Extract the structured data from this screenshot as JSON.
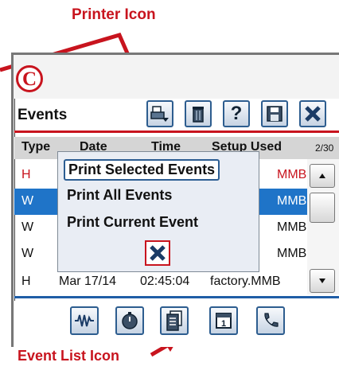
{
  "annotations": {
    "top_label": "Printer Icon",
    "bottom_label": "Event List Icon",
    "badge": "C"
  },
  "screen": {
    "title": "Events"
  },
  "table": {
    "headers": [
      "Type",
      "Date",
      "Time",
      "Setup Used"
    ],
    "count": "2/30",
    "rows": [
      {
        "type": "H",
        "date": "",
        "time": "",
        "setup_suffix": "MMB"
      },
      {
        "type": "W",
        "date": "",
        "time": "",
        "setup_suffix": "MMB"
      },
      {
        "type": "W",
        "date": "",
        "time": "",
        "setup_suffix": "MMB"
      },
      {
        "type": "W",
        "date": "",
        "time": "",
        "setup_suffix": "MMB"
      },
      {
        "type": "H",
        "date": "Mar 17/14",
        "time": "02:45:04",
        "setup": "factory.MMB"
      }
    ]
  },
  "print_menu": {
    "items": [
      "Print Selected Events",
      "Print All Events",
      "Print Current Event"
    ]
  },
  "icons": {
    "toolbar": [
      "printer-icon",
      "trash-icon",
      "help-icon",
      "save-icon",
      "close-icon"
    ],
    "nav": [
      "waveform-icon",
      "timer-icon",
      "event-list-icon",
      "calendar-icon",
      "phone-icon"
    ]
  },
  "colors": {
    "accent": "#c8141e",
    "selection": "#1f74c8",
    "button_border": "#2d5d8f"
  }
}
